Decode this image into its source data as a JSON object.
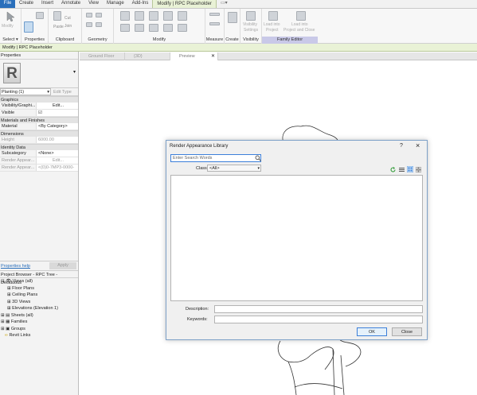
{
  "tabs": [
    "File",
    "Create",
    "Insert",
    "Annotate",
    "View",
    "Manage",
    "Add-Ins",
    "Modify | RPC Placeholder"
  ],
  "ribbon": {
    "panels": [
      "Select",
      "Properties",
      "Clipboard",
      "Geometry",
      "Modify",
      "Measure",
      "Create",
      "Visibility",
      "Family Editor"
    ],
    "select_arrow": "▾",
    "buttons": {
      "modify": "Modify",
      "paste": "Paste",
      "cut": "Cut",
      "join": "Join",
      "visibility_line1": "Visibility",
      "visibility_line2": "Settings",
      "load_project_line1": "Load into",
      "load_project_line2": "Project",
      "load_close_line1": "Load into",
      "load_close_line2": "Project and Close"
    }
  },
  "context_bar": "Modify | RPC Placeholder",
  "properties": {
    "title": "Properties",
    "type_name": "Planting (1)",
    "edit_type": "Edit Type",
    "sections": {
      "graphics": "Graphics",
      "materials": "Materials and Finishes",
      "dimensions": "Dimensions",
      "identity": "Identity Data"
    },
    "rows": {
      "vis_k": "Visibility/Graphi...",
      "vis_v": "Edit...",
      "visible_k": "Visible",
      "visible_v": "☑",
      "material_k": "Material",
      "material_v": "<By Category>",
      "height_k": "Height",
      "height_v": "6000.00",
      "subcat_k": "Subcategory",
      "subcat_v": "<None>",
      "ra1_k": "Render Appear...",
      "ra1_v": "Edit...",
      "ra2_k": "Render Appear...",
      "ra2_v": "<(0)0-7MP3-0000-"
    },
    "help": "Properties help",
    "apply": "Apply"
  },
  "browser": {
    "title": "Project Browser - RPC Tree - Deciduous",
    "items": [
      "Views (all)",
      "Floor Plans",
      "Ceiling Plans",
      "3D Views",
      "Elevations (Elevation 1)",
      "Sheets (all)",
      "Families",
      "Groups",
      "Revit Links"
    ]
  },
  "view_tabs": [
    "Ground Floor",
    "{3D}",
    "Preview"
  ],
  "dialog": {
    "title": "Render Appearance Library",
    "help": "?",
    "close_x": "×",
    "search_placeholder": "Enter Search Words",
    "class_label": "Class:",
    "class_value": "<All>",
    "description_label": "Description:",
    "keywords_label": "Keywords:",
    "ok": "OK",
    "close": "Close"
  },
  "colors": {
    "accent": "#2a6fbb",
    "context": "#e9f2d6",
    "family_editor": "#c9c9e8",
    "dialog_border": "#7ea1c8"
  }
}
